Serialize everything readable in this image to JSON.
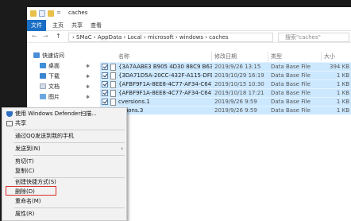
{
  "window": {
    "title": "caches",
    "pin_glyph": "="
  },
  "ribbon": {
    "file": "文件",
    "tabs": [
      "主页",
      "共享",
      "查看"
    ]
  },
  "navigation": {
    "back": "←",
    "forward": "→",
    "up": "↑",
    "path": "›  SMaC  ›  AppData  ›  Local  ›  microsoft  ›  windows  ›  caches",
    "search_placeholder": "搜索\"caches\""
  },
  "sidebar": {
    "items": [
      {
        "label": "快速访问",
        "icon": "star-icon"
      },
      {
        "label": "桌面",
        "icon": "desktop-icon",
        "pinned": true
      },
      {
        "label": "下载",
        "icon": "download-icon",
        "pinned": true
      },
      {
        "label": "文档",
        "icon": "document-icon",
        "pinned": true
      },
      {
        "label": "图片",
        "icon": "picture-icon",
        "pinned": true
      }
    ]
  },
  "columns": {
    "name": "名称",
    "date": "修改日期",
    "type": "类型",
    "size": "大小"
  },
  "files": [
    {
      "name": "{3A7AABE3 B905 4D30 88C9 B63...",
      "date": "2019/9/26 13:15",
      "type": "Data Base File",
      "size": "394 KB"
    },
    {
      "name": "{3DA71D5A-20CC-432F-A115-DFE...",
      "date": "2019/10/29 16:19",
      "type": "Data Base File",
      "size": "1 KB"
    },
    {
      "name": "{AFBF9F1A-8EE8-4C77-AF34-C647...",
      "date": "2019/10/15 10:30",
      "type": "Data Base File",
      "size": "1 KB"
    },
    {
      "name": "{AFBF9F1A-8EE8-4C77-AF34-C647...",
      "date": "2019/10/18 17:21",
      "type": "Data Base File",
      "size": "1 KB"
    },
    {
      "name": "cversions.1",
      "date": "2019/9/26 9:59",
      "type": "Data Base File",
      "size": "1 KB"
    },
    {
      "name": "...sions.3",
      "date": "2019/9/26 9:59",
      "type": "Data Base File",
      "size": "1 KB"
    }
  ],
  "context_menu": {
    "items": [
      {
        "label": "使用 Windows Defender扫描...",
        "icon": "shield-icon"
      },
      {
        "label": "共享",
        "icon": "share-icon"
      },
      {
        "label": "通过QQ发送到我的手机"
      },
      {
        "label": "发送到(N)",
        "submenu": true
      },
      {
        "label": "剪切(T)"
      },
      {
        "label": "复制(C)"
      },
      {
        "label": "创建快捷方式(S)"
      },
      {
        "label": "删除(D)",
        "highlighted": true
      },
      {
        "label": "重命名(M)"
      },
      {
        "label": "属性(R)"
      }
    ],
    "submenu_glyph": "›"
  },
  "colors": {
    "selection": "#cce8ff",
    "file_tab": "#1a6fc4",
    "highlight_border": "#d62e2e"
  }
}
